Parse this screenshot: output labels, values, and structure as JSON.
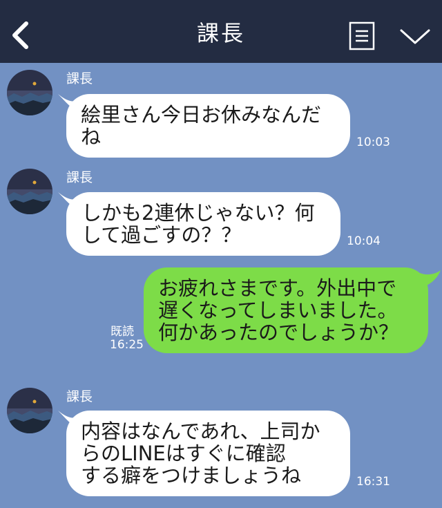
{
  "header": {
    "title": "課長",
    "back_icon": "chevron-left-icon",
    "menu_icon": "note-menu-icon",
    "more_icon": "chevron-down-icon",
    "background": "#232c42"
  },
  "chat": {
    "background": "#7291c3",
    "messages": [
      {
        "direction": "incoming",
        "sender": "課長",
        "lines": [
          "絵里さん今日お休みなんだ",
          "ね"
        ],
        "time": "10:03"
      },
      {
        "direction": "incoming",
        "sender": "課長",
        "lines": [
          "しかも2連休じゃない？何",
          "して過ごすの？？"
        ],
        "time": "10:04"
      },
      {
        "direction": "outgoing",
        "lines": [
          "お疲れさまです。外出中で",
          "遅くなってしまいました。",
          "何かあったのでしょうか？"
        ],
        "read_label": "既読",
        "time": "16:25"
      },
      {
        "direction": "incoming",
        "sender": "課長",
        "lines": [
          "内容はなんであれ、上司か",
          "らのLINEはすぐに確認",
          "する癖をつけましょうね"
        ],
        "time": "16:31"
      }
    ]
  },
  "colors": {
    "incoming_bubble": "#ffffff",
    "outgoing_bubble": "#7ddc48",
    "text": "#1a1a1a",
    "meta_text": "#ffffff"
  }
}
